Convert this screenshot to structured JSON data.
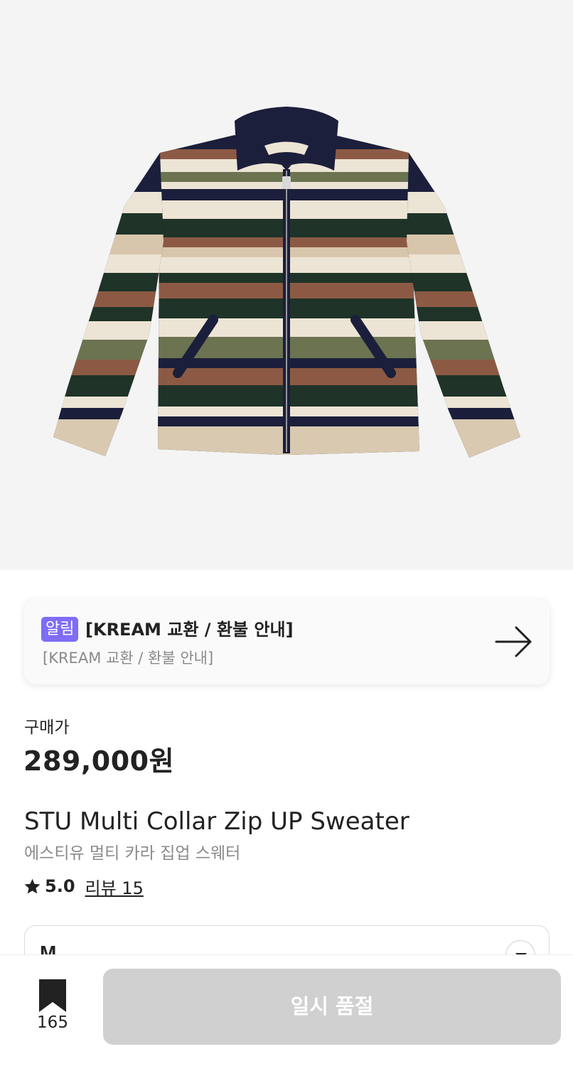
{
  "product": {
    "image_alt": "STU Multi Collar Zip UP Sweater",
    "colors": {
      "navy": "#1b1f3b",
      "cream": "#ece4d4",
      "olive": "#6b7350",
      "brown": "#8c5a44",
      "green": "#1f3328"
    }
  },
  "notice": {
    "badge": "알림",
    "title": "[KREAM 교환 / 환불 안내]",
    "subtitle": "[KREAM 교환 / 환불 안내]",
    "icon": "arrow-right-icon",
    "badge_color": "#7d6df7"
  },
  "price": {
    "label": "구매가",
    "value": "289,000원"
  },
  "name": {
    "english": "STU Multi Collar Zip UP Sweater",
    "korean": "에스티유 멀티 카라 집업 스웨터"
  },
  "rating": {
    "icon": "star-icon",
    "value": "5.0",
    "review_link": "리뷰 15"
  },
  "size_selector": {
    "selected": "M",
    "icon": "caret-down-icon"
  },
  "bottom_bar": {
    "bookmark_icon": "bookmark-icon",
    "bookmark_count": "165",
    "action_label": "일시 품절",
    "action_color": "#d0d0d0"
  }
}
